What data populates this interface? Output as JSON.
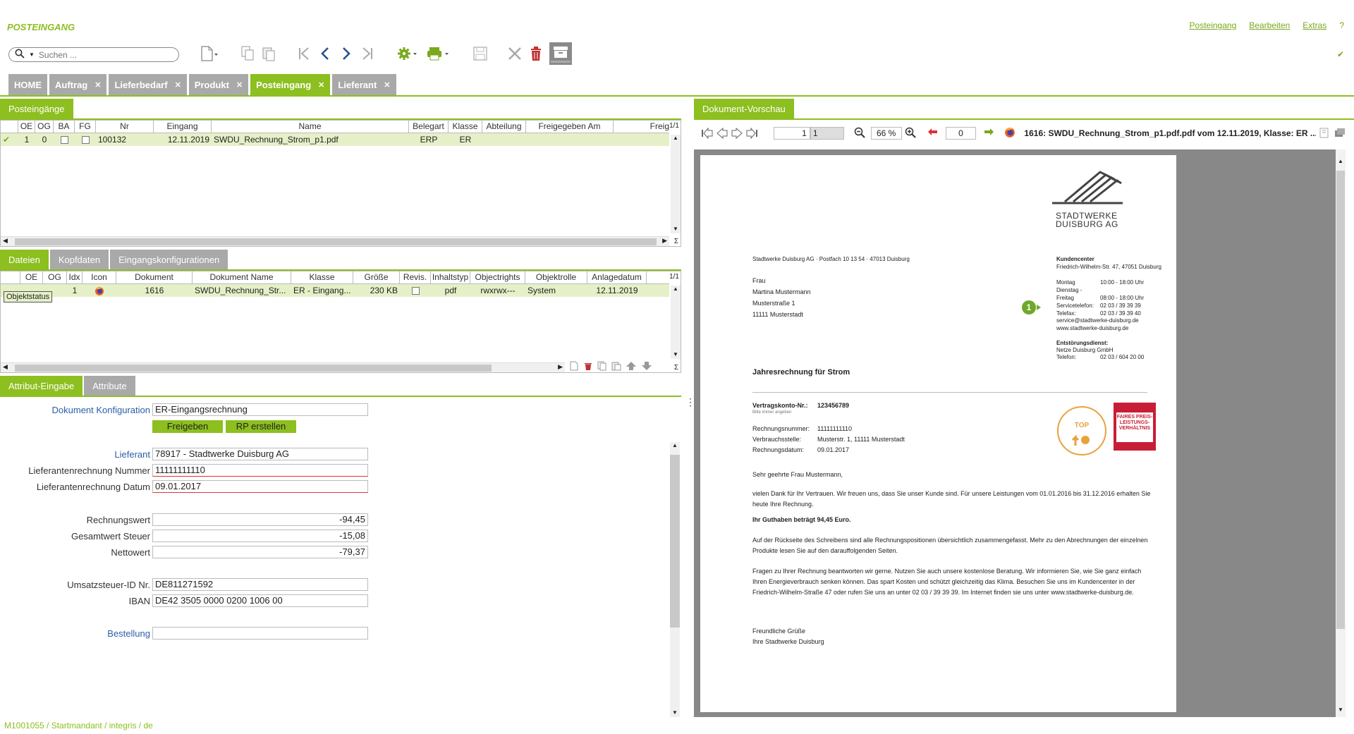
{
  "app": {
    "title": "POSTEINGANG"
  },
  "topmenu": {
    "posteingang": "Posteingang",
    "bearbeiten": "Bearbeiten",
    "extras": "Extras",
    "help": "?"
  },
  "search": {
    "placeholder": "Suchen ..."
  },
  "tabs": [
    {
      "label": "HOME"
    },
    {
      "label": "Auftrag"
    },
    {
      "label": "Lieferbedarf"
    },
    {
      "label": "Produkt"
    },
    {
      "label": "Posteingang"
    },
    {
      "label": "Lieferant"
    }
  ],
  "inbox": {
    "tab": "Posteingänge",
    "pager": "1/1",
    "columns": [
      "OE",
      "OG",
      "BA",
      "FG",
      "Nr",
      "Eingang",
      "Name",
      "Belegart",
      "Klasse",
      "Abteilung",
      "Freigegeben Am",
      "Freig"
    ],
    "row": {
      "oe": "1",
      "og": "0",
      "nr": "100132",
      "eingang": "12.11.2019",
      "name": "SWDU_Rechnung_Strom_p1.pdf",
      "belegart": "ERP",
      "klasse": "ER"
    }
  },
  "files": {
    "tabs": [
      "Dateien",
      "Kopfdaten",
      "Eingangskonfigurationen"
    ],
    "pager": "1/1",
    "columns": [
      "OE",
      "OG",
      "Idx",
      "Icon",
      "Dokument",
      "Dokument Name",
      "Klasse",
      "Größe",
      "Revis.",
      "Inhaltstyp",
      "Objectrights",
      "Objektrolle",
      "Anlagedatum"
    ],
    "tooltip": "Objektstatus",
    "row": {
      "idx": "1",
      "dokument": "1616",
      "name": "SWDU_Rechnung_Str...",
      "klasse": "ER - Eingang...",
      "groesse": "230 KB",
      "inhaltstyp": "pdf",
      "rights": "rwxrwx---",
      "rolle": "System",
      "datum": "12.11.2019"
    }
  },
  "attr": {
    "tabs": [
      "Attribut-Eingabe",
      "Attribute"
    ],
    "dokkonf_label": "Dokument Konfiguration",
    "dokkonf_value": "ER-Eingangsrechnung",
    "btn_freigeben": "Freigeben",
    "btn_rp": "RP erstellen",
    "lieferant_label": "Lieferant",
    "lieferant_value": "78917 - Stadtwerke Duisburg AG",
    "lrnr_label": "Lieferantenrechnung Nummer",
    "lrnr_value": "11111111110",
    "lrdat_label": "Lieferantenrechnung Datum",
    "lrdat_value": "09.01.2017",
    "rw_label": "Rechnungswert",
    "rw_value": "-94,45",
    "gs_label": "Gesamtwert Steuer",
    "gs_value": "-15,08",
    "nw_label": "Nettowert",
    "nw_value": "-79,37",
    "ust_label": "Umsatzsteuer-ID Nr.",
    "ust_value": "DE811271592",
    "iban_label": "IBAN",
    "iban_value": "DE42 3505 0000 0200 1006 00",
    "best_label": "Bestellung",
    "best_value": ""
  },
  "footer": "M1001055 / Startmandant / integris / de",
  "preview": {
    "tab": "Dokument-Vorschau",
    "page": "1",
    "page_total": "1",
    "zoom": "66 %",
    "rotate": "0",
    "title": "1616: SWDU_Rechnung_Strom_p1.pdf.pdf vom 12.11.2019, Klasse: ER ..."
  },
  "doc": {
    "logo1": "STADTWERKE",
    "logo2": "DUISBURG AG",
    "sender": "Stadtwerke Duisburg AG · Postfach 10 13 54 · 47013 Duisburg",
    "addr": [
      "Frau",
      "Martina Mustermann",
      "Musterstraße 1",
      "11111 Musterstadt"
    ],
    "kc_title": "Kundencenter",
    "kc_addr": "Friedrich-Wilhelm-Str. 47, 47051 Duisburg",
    "kc_rows": [
      [
        "Montag",
        "10:00 - 18:00 Uhr"
      ],
      [
        "Dienstag - Freitag",
        "08:00 - 18:00 Uhr"
      ],
      [
        "Servicetelefon:",
        "02 03 / 39 39 39"
      ],
      [
        "Telefax:",
        "02 03 / 39 39 40"
      ]
    ],
    "mail": "service@stadtwerke-duisburg.de",
    "web": "www.stadtwerke-duisburg.de",
    "ent_title": "Entstörungsdienst:",
    "ent_name": "Netze Duisburg GmbH",
    "ent_tel_l": "Telefon:",
    "ent_tel_v": "02 03 / 604 20 00",
    "badge": "1",
    "heading": "Jahresrechnung für Strom",
    "vk_label": "Vertragskonto-Nr.:",
    "vk_value": "123456789",
    "vk_note": "Bitte immer angeben",
    "rn_label": "Rechnungsnummer:",
    "rn_value": "11111111110",
    "vs_label": "Verbrauchsstelle:",
    "vs_value": "Musterstr. 1, 11111 Musterstadt",
    "rd_label": "Rechnungsdatum:",
    "rd_value": "09.01.2017",
    "seal1": "TOP",
    "seal2": "FAIRES PREIS-LEISTUNGS-VERHÄLTNIS",
    "greet": "Sehr geehrte Frau Mustermann,",
    "p1": "vielen Dank für Ihr Vertrauen. Wir freuen uns, dass Sie unser Kunde sind. Für unsere Leistungen vom 01.01.2016 bis 31.12.2016 erhalten Sie",
    "p1b": "heute Ihre Rechnung.",
    "p2": "Ihr Guthaben beträgt 94,45 Euro.",
    "p3": "Auf der Rückseite des Schreibens sind alle Rechnungspositionen übersichtlich zusammengefasst. Mehr zu den Abrechnungen der einzelnen",
    "p3b": "Produkte lesen Sie auf den darauffolgenden Seiten.",
    "p4": "Fragen zu Ihrer Rechnung beantworten wir gerne. Nutzen Sie auch unsere kostenlose Beratung. Wir informieren Sie, wie Sie ganz einfach",
    "p4b": "Ihren Energieverbrauch senken können. Das spart Kosten und schützt gleichzeitig das Klima. Besuchen Sie uns im Kundencenter in der",
    "p4c": "Friedrich-Wilhelm-Straße 47 oder rufen Sie uns an unter 02 03 / 39 39 39. Im Internet finden sie uns unter www.stadtwerke-duisburg.de.",
    "close1": "Freundliche Grüße",
    "close2": "Ihre Stadtwerke Duisburg"
  },
  "colors": {
    "accent": "#8cbf1f",
    "tab_gray": "#a9a9a9",
    "row_sel": "#e5f0c8",
    "link": "#2a5fa8"
  }
}
